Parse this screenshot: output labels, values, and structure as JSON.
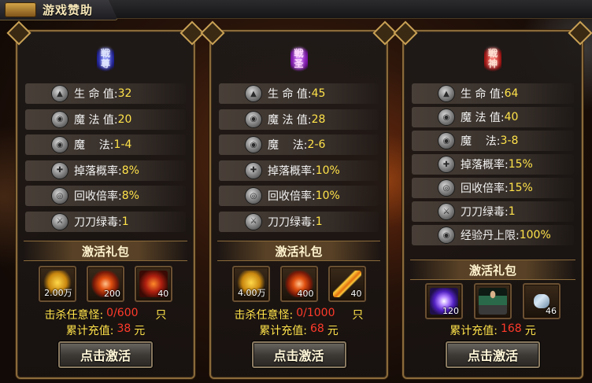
{
  "window": {
    "title": "游戏赞助"
  },
  "panels": [
    {
      "emblem": "戦\n尊",
      "emblem_color": "#3a4aff",
      "stats": [
        {
          "label": "生 命 值:",
          "value": "32",
          "icon": "life-icon"
        },
        {
          "label": "魔 法 值:",
          "value": "20",
          "icon": "mana-icon"
        },
        {
          "label": "魔    法:",
          "value": "1-4",
          "icon": "magic-icon"
        },
        {
          "label": "掉落概率:",
          "value": "8%",
          "icon": "drop-rate-icon"
        },
        {
          "label": "回收倍率:",
          "value": "8%",
          "icon": "recycle-rate-icon"
        },
        {
          "label": "刀刀绿毒:",
          "value": "1",
          "icon": "poison-blade-icon"
        }
      ],
      "gift_title": "激活礼包",
      "items": [
        {
          "name": "gold-ingot-icon",
          "count": "2.00万"
        },
        {
          "name": "fire-orb-icon",
          "count": "200"
        },
        {
          "name": "crimson-helm-icon",
          "count": "40"
        }
      ],
      "kill_label": "击杀任意怪:",
      "kill_progress": "0/600",
      "kill_unit": "只",
      "recharge_label": "累计充值:",
      "recharge_amount": "38",
      "recharge_unit": "元",
      "button": "点击激活"
    },
    {
      "emblem": "戦\n圣",
      "emblem_color": "#c040ff",
      "stats": [
        {
          "label": "生 命 值:",
          "value": "45",
          "icon": "life-icon"
        },
        {
          "label": "魔 法 值:",
          "value": "28",
          "icon": "mana-icon"
        },
        {
          "label": "魔    法:",
          "value": "2-6",
          "icon": "magic-icon"
        },
        {
          "label": "掉落概率:",
          "value": "10%",
          "icon": "drop-rate-icon"
        },
        {
          "label": "回收倍率:",
          "value": "10%",
          "icon": "recycle-rate-icon"
        },
        {
          "label": "刀刀绿毒:",
          "value": "1",
          "icon": "poison-blade-icon"
        }
      ],
      "gift_title": "激活礼包",
      "items": [
        {
          "name": "gold-ingot-icon",
          "count": "4.00万"
        },
        {
          "name": "fire-orb-icon",
          "count": "400"
        },
        {
          "name": "flame-sword-icon",
          "count": "40"
        }
      ],
      "kill_label": "击杀任意怪:",
      "kill_progress": "0/1000",
      "kill_unit": "只",
      "recharge_label": "累计充值:",
      "recharge_amount": "68",
      "recharge_unit": "元",
      "button": "点击激活"
    },
    {
      "emblem": "戦\n神",
      "emblem_color": "#ff2a1a",
      "stats": [
        {
          "label": "生 命 值:",
          "value": "64",
          "icon": "life-icon"
        },
        {
          "label": "魔 法 值:",
          "value": "40",
          "icon": "mana-icon"
        },
        {
          "label": "魔    法:",
          "value": "3-8",
          "icon": "magic-icon"
        },
        {
          "label": "掉落概率:",
          "value": "15%",
          "icon": "drop-rate-icon"
        },
        {
          "label": "回收倍率:",
          "value": "15%",
          "icon": "recycle-rate-icon"
        },
        {
          "label": "刀刀绿毒:",
          "value": "1",
          "icon": "poison-blade-icon"
        },
        {
          "label": "经验丹上限:",
          "value": "100%",
          "icon": "exp-cap-icon"
        }
      ],
      "gift_title": "激活礼包",
      "items": [
        {
          "name": "purple-vortex-icon",
          "count": "120"
        },
        {
          "name": "outfit-figure-icon",
          "count": ""
        },
        {
          "name": "scroll-icon",
          "count": "46"
        }
      ],
      "recharge_label": "累计充值:",
      "recharge_amount": "168",
      "recharge_unit": "元",
      "button": "点击激活"
    }
  ]
}
